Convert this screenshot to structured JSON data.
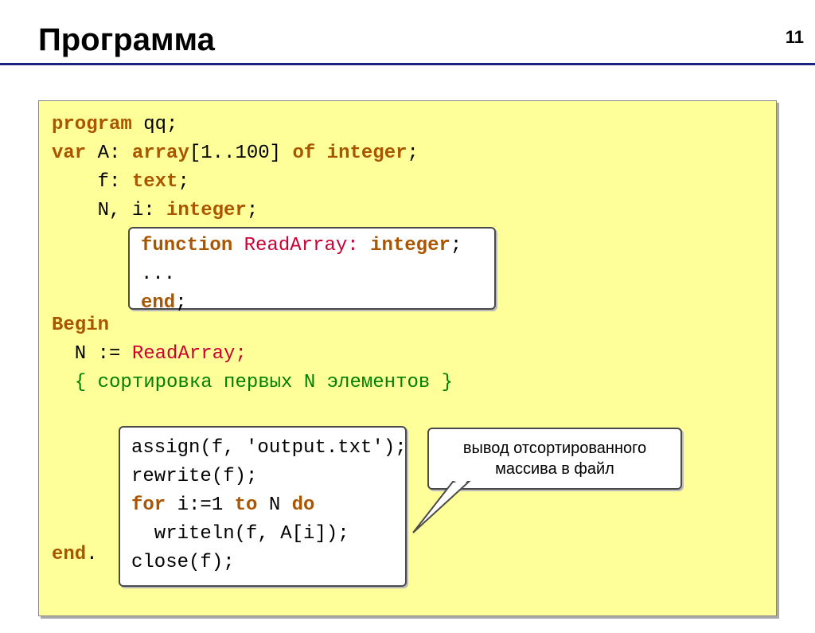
{
  "page_number": "11",
  "slide_title": "Программа",
  "code": {
    "l1_kw": "program ",
    "l1_rest": "qq;",
    "l2_kw": "var ",
    "l2_rest": "A: ",
    "l2_kw2": "array",
    "l2_rest2": "[1..100] ",
    "l2_kw3": "of integer",
    "l2_rest3": ";",
    "l3": "    f: ",
    "l3_kw": "text",
    "l3_rest": ";",
    "l4": "    N, i: ",
    "l4_kw": "integer",
    "l4_rest": ";",
    "fun_l1_kw": "function ",
    "fun_l1_name": "ReadArray: ",
    "fun_l1_kw2": "integer",
    "fun_l1_rest": ";",
    "fun_l2": "...",
    "fun_l3_kw": "end",
    "fun_l3_rest": ";",
    "l5_kw": "Begin",
    "l6": "  N := ",
    "l6_call": "ReadArray;",
    "l7_comment": "  { сортировка первых N элементов }",
    "out_l1": "assign(f, 'output.txt');",
    "out_l2": "rewrite(f);",
    "out_l3_kw": "for ",
    "out_l3_mid": "i:=1 ",
    "out_l3_kw2": "to ",
    "out_l3_mid2": "N ",
    "out_l3_kw3": "do",
    "out_l4": "  writeln(f, A[i]);",
    "out_l5": "close(f);",
    "l_end_kw": "end",
    "l_end_dot": "."
  },
  "callout_text": "вывод отсортированного массива в файл"
}
